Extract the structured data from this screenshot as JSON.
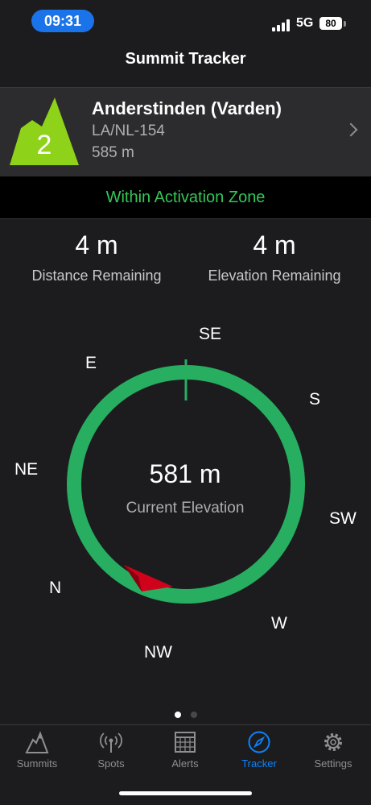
{
  "status": {
    "time": "09:31",
    "network": "5G",
    "battery": "80"
  },
  "header": {
    "title": "Summit Tracker"
  },
  "summit": {
    "points": "2",
    "name": "Anderstinden (Varden)",
    "reference": "LA/NL-154",
    "altitude": "585 m",
    "icon_color": "#8ed21a"
  },
  "zone": {
    "text": "Within Activation Zone",
    "color": "#34c759"
  },
  "stats": {
    "distance_value": "4 m",
    "distance_label": "Distance Remaining",
    "elevation_value": "4 m",
    "elevation_label": "Elevation Remaining"
  },
  "compass": {
    "directions": {
      "e": "E",
      "se": "SE",
      "s": "S",
      "sw": "SW",
      "w": "W",
      "nw": "NW",
      "n": "N",
      "ne": "NE"
    },
    "ring_color": "#27ae60",
    "pointer_color": "#d0021b",
    "current_elevation_value": "581 m",
    "current_elevation_label": "Current Elevation"
  },
  "pager": {
    "count": 2,
    "active": 0
  },
  "tabs": [
    {
      "label": "Summits",
      "icon": "mountain-icon"
    },
    {
      "label": "Spots",
      "icon": "antenna-icon"
    },
    {
      "label": "Alerts",
      "icon": "calendar-icon"
    },
    {
      "label": "Tracker",
      "icon": "compass-icon",
      "active": true
    },
    {
      "label": "Settings",
      "icon": "gear-icon"
    }
  ]
}
